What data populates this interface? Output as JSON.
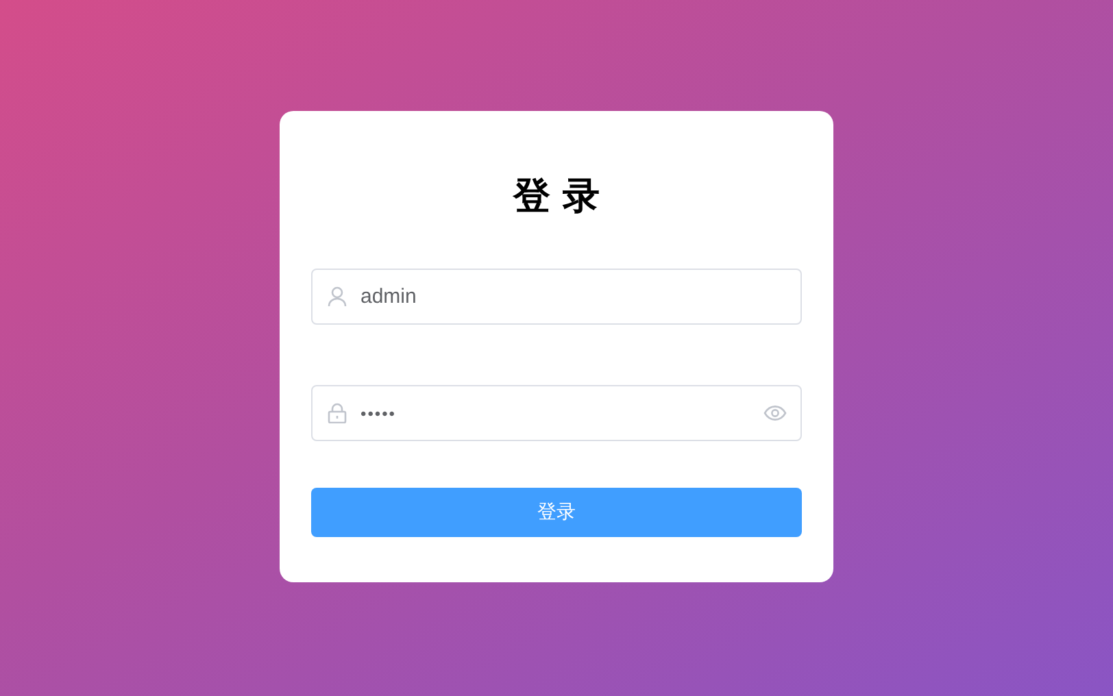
{
  "title": "登 录",
  "fields": [
    {
      "kind": "user",
      "value": "admin"
    },
    {
      "kind": "password",
      "value": "•••••"
    }
  ],
  "submit": "登录"
}
